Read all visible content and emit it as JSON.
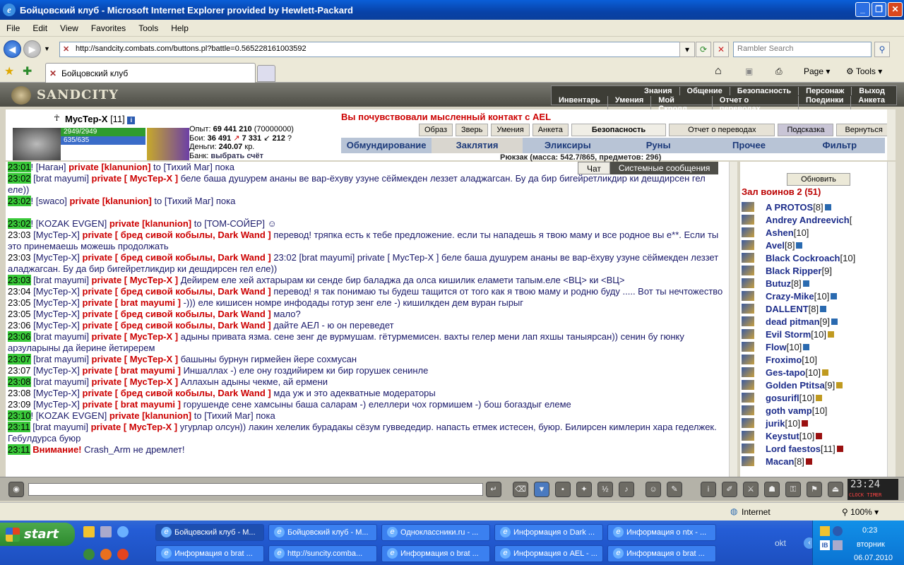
{
  "window": {
    "title": "Бойцовский клуб - Microsoft Internet Explorer provided by Hewlett-Packard"
  },
  "menu": [
    "File",
    "Edit",
    "View",
    "Favorites",
    "Tools",
    "Help"
  ],
  "address": {
    "url": "http://sandcity.combats.com/buttons.pl?battle=0.565228161003592",
    "search_placeholder": "Rambler Search"
  },
  "tab": {
    "label": "Бойцовский клуб"
  },
  "toolbar": {
    "page": "Page",
    "tools": "Tools"
  },
  "game": {
    "logo": "SANDCITY",
    "topnav_row1": [
      "Знания",
      "Общение",
      "Безопасность",
      "Персонаж",
      "Выход"
    ],
    "topnav_row2": [
      "Инвентарь",
      "Умения",
      "Мой Скролл",
      "Отчет о переводах",
      "Поединки",
      "Анкета"
    ],
    "player": {
      "name": "МусТер-Х",
      "level": "[11]",
      "hp": "2949/2949",
      "mp": "635/635"
    },
    "stats": {
      "exp_label": "Опыт:",
      "exp": "69 441 210",
      "exp_next": "(70000000)",
      "fights_label": "Бои:",
      "wins": "36 491",
      "losses": "7 331",
      "draws": "212",
      "money_label": "Деньги:",
      "money": "240.07",
      "money_unit": "кр.",
      "bank_label": "Банк:",
      "bank_link": "выбрать счёт"
    },
    "alert": "Вы почувствовали мысленный контакт с AEL",
    "buttons": [
      "Образ",
      "Зверь",
      "Умения",
      "Анкета",
      "Безопасность",
      "Отчет о переводах",
      "Подсказка",
      "Вернуться"
    ],
    "tabs": [
      "Обмундирование",
      "Заклятия",
      "Эликсиры",
      "Руны",
      "Прочее",
      "Фильтр"
    ],
    "selected_tab": "Заклятия",
    "backpack": "Рюкзак (масса: 542.7/865, предметов: 296)",
    "chat_tabs": [
      "Чат",
      "Системные сообщения"
    ],
    "refresh": "Обновить",
    "hall": "Зал воинов 2 (51)",
    "clock": "23:24",
    "clock_labels": "CLOCK TIMER"
  },
  "chat": [
    {
      "time": "23:01",
      "hl": true,
      "pre": "! [",
      "nick": "Наган",
      "post": "] ",
      "priv": "private [klanunion]",
      "text": " to [Тихий Маг] пока"
    },
    {
      "time": "23:02",
      "hl": true,
      "pre": " [",
      "nick": "brat mayumi",
      "post": "] ",
      "priv": "private [ МусТер-Х ]",
      "text": " беле баша душурем ананы ве вар-ёхуву узуне сёймекден леззет аладжагсан. Бу да бир бигейретликдир ки дешдирсен гел еле))"
    },
    {
      "time": "23:02",
      "hl": true,
      "pre": "! [",
      "nick": "swaco",
      "post": "] ",
      "priv": "private [klanunion]",
      "text": " to [Тихий Маг] пока"
    },
    {
      "time": "",
      "hl": false,
      "pre": "",
      "nick": "",
      "post": "",
      "priv": "",
      "text": ""
    },
    {
      "time": "23:02",
      "hl": true,
      "pre": "! [",
      "nick": "KOZAK EVGEN",
      "post": "] ",
      "priv": "private [klanunion]",
      "text": " to [ТОМ-СОЙЕР] ☺"
    },
    {
      "time": "23:03",
      "hl": false,
      "pre": " [",
      "nick": "МусТер-Х",
      "post": "] ",
      "priv": "private [ бред сивой кобылы, Dark Wand ]",
      "text": " перевод! тряпка есть к тебе предложение. если ты нападешь я твою маму и все родное вы е**. Если ты это принемаешь можешь продолжать"
    },
    {
      "time": "23:03",
      "hl": false,
      "pre": " [",
      "nick": "МусТер-Х",
      "post": "] ",
      "priv": "private [ бред сивой кобылы, Dark Wand ]",
      "text": " 23:02 [brat mayumi] private [ МусТер-Х ] беле баша душурем ананы ве вар-ёхуву узуне сёймекден леззет аладжагсан. Бу да бир бигейретликдир ки дешдирсен гел еле))"
    },
    {
      "time": "23:03",
      "hl": true,
      "pre": " [",
      "nick": "brat mayumi",
      "post": "] ",
      "priv": "private [ МусТер-Х ]",
      "text": " Дейирем еле хей ахтарырам ки сенде бир баладжа да олса кишилик еламети тапым.еле <ВЦ> ки <ВЦ>"
    },
    {
      "time": "23:04",
      "hl": false,
      "pre": " [",
      "nick": "МусТер-Х",
      "post": "] ",
      "priv": "private [ бред сивой кобылы, Dark Wand ]",
      "text": " перевод! я так понимаю ты будеш тащится от того как я твою маму и родню буду ..... Вот ты нечтожество"
    },
    {
      "time": "23:05",
      "hl": false,
      "pre": " [",
      "nick": "МусТер-Х",
      "post": "] ",
      "priv": "private [ brat mayumi ]",
      "text": " -))) еле кишисен номре инфодады готур зенг еле -) кишилкден дем вуран гырыг"
    },
    {
      "time": "23:05",
      "hl": false,
      "pre": " [",
      "nick": "МусТер-Х",
      "post": "] ",
      "priv": "private [ бред сивой кобылы, Dark Wand ]",
      "text": " мало?"
    },
    {
      "time": "23:06",
      "hl": false,
      "pre": " [",
      "nick": "МусТер-Х",
      "post": "] ",
      "priv": "private [ бред сивой кобылы, Dark Wand ]",
      "text": " дайте АЕЛ - ю он переведет"
    },
    {
      "time": "23:06",
      "hl": true,
      "pre": " [",
      "nick": "brat mayumi",
      "post": "] ",
      "priv": "private [ МусТер-Х ]",
      "text": " адыны привата язма. сене зенг де вурмушам. гётурмемисен. вахты гелер мени лап яхшы таныярсан)) сенин бу гюнку арзуларыны да йерине йетиререм"
    },
    {
      "time": "23:07",
      "hl": true,
      "pre": " [",
      "nick": "brat mayumi",
      "post": "] ",
      "priv": "private [ МусТер-Х ]",
      "text": " башыны бурнун гирмейен йере сохмусан"
    },
    {
      "time": "23:07",
      "hl": false,
      "pre": " [",
      "nick": "МусТер-Х",
      "post": "] ",
      "priv": "private [ brat mayumi ]",
      "text": " Иншаллах -) еле ону гоздийирем ки бир горушек сенинле"
    },
    {
      "time": "23:08",
      "hl": true,
      "pre": " [",
      "nick": "brat mayumi",
      "post": "] ",
      "priv": "private [ МусТер-Х ]",
      "text": " Аллахын адыны чекме, ай ермени"
    },
    {
      "time": "23:08",
      "hl": false,
      "pre": " [",
      "nick": "МусТер-Х",
      "post": "] ",
      "priv": "private [ бред сивой кобылы, Dark Wand ]",
      "text": " мда уж и это адекватные модераторы"
    },
    {
      "time": "23:09",
      "hl": false,
      "pre": " [",
      "nick": "МусТер-Х",
      "post": "] ",
      "priv": "private [ brat mayumi ]",
      "text": " горушенде сене хамсыны баша саларам -) елеллери чох гормишем -) бош богаздыг елеме"
    },
    {
      "time": "23:10",
      "hl": true,
      "pre": "! [",
      "nick": "KOZAK EVGEN",
      "post": "] ",
      "priv": "private [klanunion]",
      "text": " to [Тихий Маг] пока"
    },
    {
      "time": "23:11",
      "hl": true,
      "pre": " [",
      "nick": "brat mayumi",
      "post": "] ",
      "priv": "private [ МусТер-Х ]",
      "text": " угурлар олсун)) лакин хелелик бурадакы сёзум гувведедир. напасть етмек истесен, буюр. Билирсен кимлерин хара геделжек. Гебулдурса буюр"
    },
    {
      "time": "23:11",
      "hl": true,
      "pre": " ",
      "nick": "",
      "post": "",
      "priv": "Внимание!",
      "text": " Crash_Arm не дремлет!"
    }
  ],
  "players": [
    {
      "name": "A PROTOS",
      "lv": "[8]",
      "badge": "blue"
    },
    {
      "name": "Andrey Andreevich",
      "lv": "[",
      "badge": ""
    },
    {
      "name": "Ashen",
      "lv": "[10]",
      "badge": ""
    },
    {
      "name": "Avel",
      "lv": "[8]",
      "badge": "blue"
    },
    {
      "name": "Black Cockroach",
      "lv": "[10]",
      "badge": ""
    },
    {
      "name": "Black Ripper",
      "lv": "[9]",
      "badge": ""
    },
    {
      "name": "Butuz",
      "lv": "[8]",
      "badge": "blue"
    },
    {
      "name": "Crazy-Mike",
      "lv": "[10]",
      "badge": "blue"
    },
    {
      "name": "DALLENT",
      "lv": "[8]",
      "badge": "blue"
    },
    {
      "name": "dead pitman",
      "lv": "[9]",
      "badge": "blue"
    },
    {
      "name": "Evil Storm",
      "lv": "[10]",
      "badge": "gold"
    },
    {
      "name": "Flow",
      "lv": "[10]",
      "badge": "blue"
    },
    {
      "name": "Froximo",
      "lv": "[10]",
      "badge": ""
    },
    {
      "name": "Ges-tapo",
      "lv": "[10]",
      "badge": "gold"
    },
    {
      "name": "Golden Ptitsa",
      "lv": "[9]",
      "badge": "gold"
    },
    {
      "name": "gosurifl",
      "lv": "[10]",
      "badge": "gold"
    },
    {
      "name": "goth vamp",
      "lv": "[10]",
      "badge": ""
    },
    {
      "name": "jurik",
      "lv": "[10]",
      "badge": "red"
    },
    {
      "name": "Keystut",
      "lv": "[10]",
      "badge": "red"
    },
    {
      "name": "Lord faestos",
      "lv": "[11]",
      "badge": "red"
    },
    {
      "name": "Macan",
      "lv": "[8]",
      "badge": "red"
    }
  ],
  "status": {
    "zone": "Internet",
    "zoom": "100%"
  },
  "taskbar": {
    "start": "start",
    "row1": [
      "Бойцовский клуб - M...",
      "Бойцовский клуб - M...",
      "Одноклассники.ru - ...",
      "Информация о Dark ...",
      "Информация о ntx - ..."
    ],
    "row2": [
      "Информация о brat ...",
      "http://suncity.comba...",
      "Информация о brat ...",
      "Информация о AEL - ...",
      "Информация о brat ..."
    ],
    "okt": "okt",
    "time": "0:23",
    "day": "вторник",
    "date": "06.07.2010"
  }
}
